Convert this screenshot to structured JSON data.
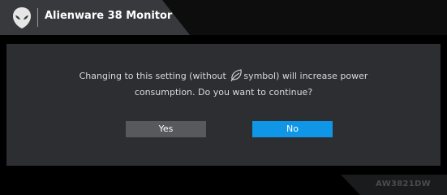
{
  "header": {
    "title": "Alienware 38 Monitor",
    "logo_icon": "alienware-alien-head-icon"
  },
  "dialog": {
    "message_part1": "Changing to this setting (without",
    "message_icon": "leaf-eco-icon",
    "message_part2": "symbol) will increase power",
    "message_line2": "consumption. Do you want to continue?",
    "yes_label": "Yes",
    "no_label": "No",
    "selected": "No"
  },
  "footer": {
    "model": "AW3821DW"
  },
  "colors": {
    "accent": "#0f96e6",
    "panel": "#2d2e31",
    "header_tab": "#38393c",
    "button_default": "#58595c"
  }
}
